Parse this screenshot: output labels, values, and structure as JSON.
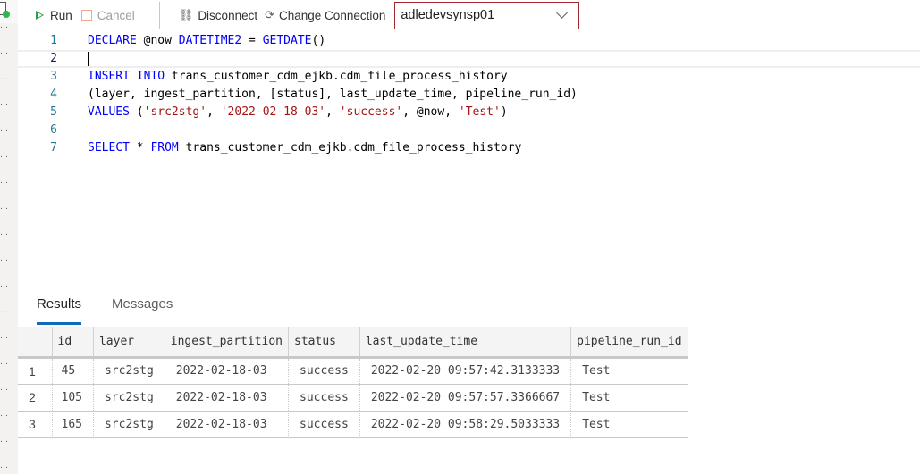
{
  "toolbar": {
    "run_label": "Run",
    "cancel_label": "Cancel",
    "disconnect_label": "Disconnect",
    "change_connection_label": "Change Connection",
    "connection": {
      "selected": "adledevsynsp01"
    },
    "icons": {
      "run": "play-icon",
      "cancel": "stop-icon",
      "disconnect": "unplug-icon",
      "change_connection": "refresh-connection-icon",
      "dropdown": "chevron-down-icon"
    }
  },
  "editor": {
    "current_line": 2,
    "lines": [
      {
        "n": "1",
        "tokens": [
          [
            "kw",
            "DECLARE"
          ],
          [
            "p",
            " @now "
          ],
          [
            "kw",
            "DATETIME2"
          ],
          [
            "p",
            " = "
          ],
          [
            "kw",
            "GETDATE"
          ],
          [
            "p",
            "()"
          ]
        ]
      },
      {
        "n": "2",
        "tokens": []
      },
      {
        "n": "3",
        "tokens": [
          [
            "kw",
            "INSERT"
          ],
          [
            "p",
            " "
          ],
          [
            "kw",
            "INTO"
          ],
          [
            "p",
            " trans_customer_cdm_ejkb.cdm_file_process_history"
          ]
        ]
      },
      {
        "n": "4",
        "tokens": [
          [
            "p",
            "(layer, ingest_partition, [status], last_update_time, pipeline_run_id)"
          ]
        ]
      },
      {
        "n": "5",
        "tokens": [
          [
            "kw",
            "VALUES"
          ],
          [
            "p",
            " ("
          ],
          [
            "str",
            "'src2stg'"
          ],
          [
            "p",
            ", "
          ],
          [
            "str",
            "'2022-02-18-03'"
          ],
          [
            "p",
            ", "
          ],
          [
            "str",
            "'success'"
          ],
          [
            "p",
            ", @now, "
          ],
          [
            "str",
            "'Test'"
          ],
          [
            "p",
            ")"
          ]
        ]
      },
      {
        "n": "6",
        "tokens": []
      },
      {
        "n": "7",
        "tokens": [
          [
            "kw",
            "SELECT"
          ],
          [
            "p",
            " * "
          ],
          [
            "kw",
            "FROM"
          ],
          [
            "p",
            " trans_customer_cdm_ejkb.cdm_file_process_history"
          ]
        ]
      }
    ]
  },
  "results": {
    "tabs": [
      {
        "label": "Results",
        "active": true
      },
      {
        "label": "Messages",
        "active": false
      }
    ],
    "columns": [
      "",
      "id",
      "layer",
      "ingest_partition",
      "status",
      "last_update_time",
      "pipeline_run_id"
    ],
    "rows": [
      [
        "1",
        "45",
        "src2stg",
        "2022-02-18-03",
        "success",
        "2022-02-20 09:57:42.3133333",
        "Test"
      ],
      [
        "2",
        "105",
        "src2stg",
        "2022-02-18-03",
        "success",
        "2022-02-20 09:57:57.3366667",
        "Test"
      ],
      [
        "3",
        "165",
        "src2stg",
        "2022-02-18-03",
        "success",
        "2022-02-20 09:58:29.5033333",
        "Test"
      ]
    ]
  },
  "colors": {
    "run_green": "#2ea043",
    "cancel_orange": "#f4a58a",
    "dropdown_border": "#a4262c",
    "keyword_blue": "#0000ff",
    "string_red": "#a31515",
    "tab_underline": "#0f6cbd"
  }
}
